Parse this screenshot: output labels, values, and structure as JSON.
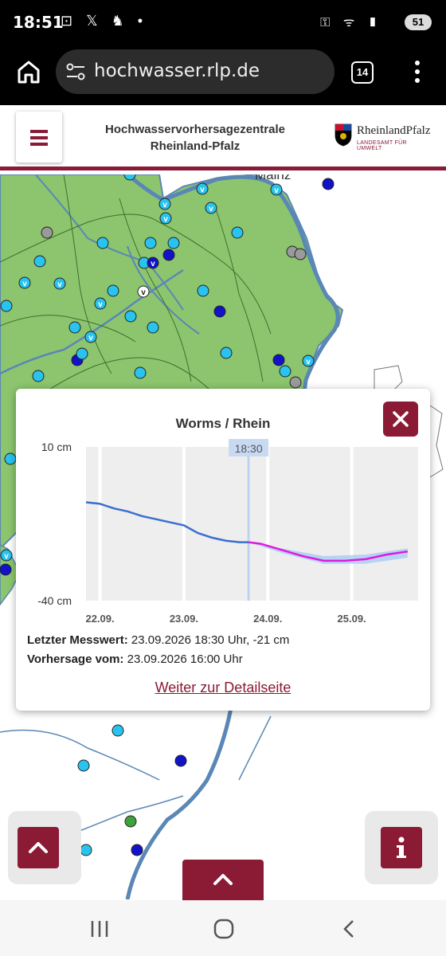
{
  "status_bar": {
    "time": "18:51",
    "left_icons": [
      "screenshot-icon",
      "x-icon",
      "food-delivery-icon",
      "dot-icon"
    ],
    "right_icons": [
      "key-icon",
      "wifi-icon",
      "signal-icon"
    ],
    "battery": "51"
  },
  "browser": {
    "url": "hochwasser.rlp.de",
    "tab_count": "14"
  },
  "site_header": {
    "title_line1": "Hochwasservorhersagezentrale",
    "title_line2": "Rheinland-Pfalz",
    "logo_name": "RheinlandPfalz",
    "logo_sub": "LANDESAMT FÜR UMWELT"
  },
  "map": {
    "city_label": "Mainz",
    "colors": {
      "land": "#8cc56e",
      "water": "#5a87b5",
      "station_light": "#29c3ef",
      "station_dark": "#1212c8",
      "station_gray": "#9a9a9a",
      "station_green": "#3ca33c"
    }
  },
  "popup": {
    "title": "Worms / Rhein",
    "current_time_label": "18:30",
    "last_value_label": "Letzter Messwert:",
    "last_value": "23.09.2026 18:30 Uhr, -21 cm",
    "forecast_label": "Vorhersage vom:",
    "forecast_value": "23.09.2026 16:00 Uhr",
    "detail_link": "Weiter zur Detailseite"
  },
  "chart_data": {
    "type": "line",
    "title": "Worms / Rhein",
    "y_tick_labels": [
      "10 cm",
      "-40 cm"
    ],
    "ylim": [
      -40,
      10
    ],
    "x_tick_labels": [
      "22.09.",
      "23.09.",
      "24.09.",
      "25.09."
    ],
    "xlim": [
      "2026-09-21T20:00",
      "2026-09-25T19:00"
    ],
    "now": "2026-09-23T18:30",
    "series": [
      {
        "role": "measured",
        "color": "#3a6fd0",
        "x": [
          "2026-09-21T20:00",
          "2026-09-22T00:00",
          "2026-09-22T04:00",
          "2026-09-22T08:00",
          "2026-09-22T12:00",
          "2026-09-22T16:00",
          "2026-09-22T20:00",
          "2026-09-23T00:00",
          "2026-09-23T04:00",
          "2026-09-23T08:00",
          "2026-09-23T12:00",
          "2026-09-23T16:00",
          "2026-09-23T18:30"
        ],
        "y": [
          -8,
          -8.5,
          -10,
          -11,
          -12.5,
          -13.5,
          -14.5,
          -15.5,
          -18,
          -19.5,
          -20.5,
          -21,
          -21
        ]
      },
      {
        "role": "forecast",
        "color": "#e019e0",
        "x": [
          "2026-09-23T18:30",
          "2026-09-23T22:00",
          "2026-09-24T04:00",
          "2026-09-24T10:00",
          "2026-09-24T16:00",
          "2026-09-24T22:00",
          "2026-09-25T04:00",
          "2026-09-25T10:00",
          "2026-09-25T16:00"
        ],
        "y": [
          -21,
          -21.5,
          -23.5,
          -25.5,
          -27,
          -27,
          -26.5,
          -25,
          -24
        ]
      }
    ],
    "forecast_band": {
      "color": "#a8cbf5",
      "x": [
        "2026-09-23T18:30",
        "2026-09-24T04:00",
        "2026-09-24T16:00",
        "2026-09-25T04:00",
        "2026-09-25T16:00"
      ],
      "upper": [
        -21,
        -23,
        -25.5,
        -25,
        -23
      ],
      "lower": [
        -21,
        -24.5,
        -28,
        -28,
        -26
      ]
    },
    "grid": true
  },
  "buttons": {
    "scroll_top": "chevron-up-icon",
    "info": "info-icon",
    "bottom_panel": "chevron-up-icon"
  },
  "system_nav": [
    "recents-icon",
    "home-icon",
    "back-icon"
  ]
}
